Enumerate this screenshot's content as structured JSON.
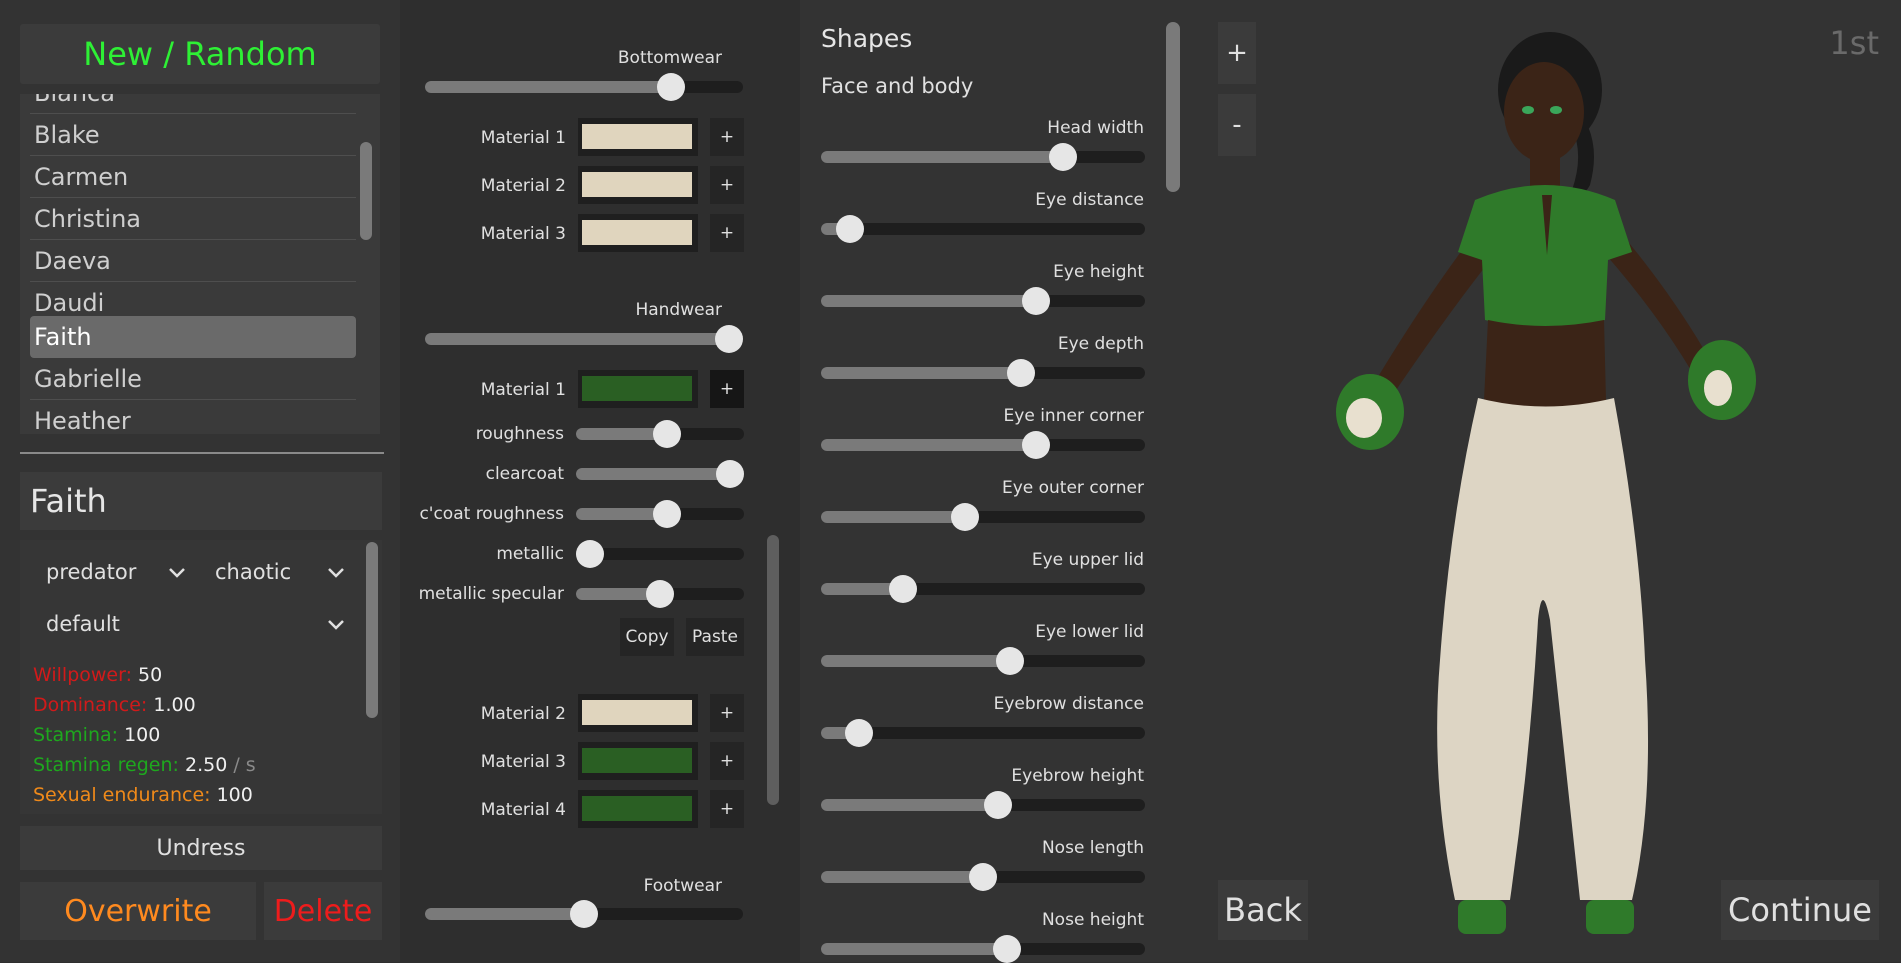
{
  "left": {
    "new_random": "New / Random",
    "names_partial": "Bianca",
    "names": [
      "Blake",
      "Carmen",
      "Christina",
      "Daeva",
      "Daudi",
      "Faith",
      "Gabrielle",
      "Heather"
    ],
    "selected_name": "Faith",
    "character_name": "Faith",
    "select_personality": "predator",
    "select_alignment": "chaotic",
    "select_preset": "default",
    "stats": {
      "willpower_label": "Willpower:",
      "willpower_value": "50",
      "dominance_label": "Dominance:",
      "dominance_value": "1.00",
      "stamina_label": "Stamina:",
      "stamina_value": "100",
      "stamina_regen_label": "Stamina regen:",
      "stamina_regen_value": "2.50",
      "stamina_regen_unit": "/ s",
      "sexual_endurance_label": "Sexual endurance:",
      "sexual_endurance_value": "100"
    },
    "undress": "Undress",
    "overwrite": "Overwrite",
    "delete": "Delete",
    "colors": {
      "new_random": "#2ef035",
      "willpower": "#d11a1a",
      "dominance": "#d11a1a",
      "stamina": "#1ea81e",
      "sexual_endurance": "#f08a1a",
      "overwrite": "#ff8a1f",
      "delete": "#ee1c1c"
    }
  },
  "clothing": {
    "bottomwear_label": "Bottomwear",
    "bottomwear_value": 0.8,
    "material_labels": [
      "Material 1",
      "Material 2",
      "Material 3"
    ],
    "bottom_swatches": [
      "#e0d5be",
      "#e0d5be",
      "#e0d5be"
    ],
    "handwear_label": "Handwear",
    "handwear_value": 1.0,
    "hand_material1_label": "Material 1",
    "hand_material1_color": "#2a5f23",
    "props": [
      {
        "label": "roughness",
        "value": 0.55
      },
      {
        "label": "clearcoat",
        "value": 1.0
      },
      {
        "label": "c'coat roughness",
        "value": 0.55
      },
      {
        "label": "metallic",
        "value": 0.0
      },
      {
        "label": "metallic specular",
        "value": 0.5
      }
    ],
    "copy": "Copy",
    "paste": "Paste",
    "hand_more": [
      {
        "label": "Material 2",
        "color": "#e0d5be"
      },
      {
        "label": "Material 3",
        "color": "#2a5f23"
      },
      {
        "label": "Material 4",
        "color": "#2a5f23"
      }
    ],
    "footwear_label": "Footwear",
    "footwear_value": 0.5,
    "plus": "+"
  },
  "shapes": {
    "title": "Shapes",
    "subtitle": "Face and body",
    "sliders": [
      {
        "label": "Head width",
        "value": 0.77
      },
      {
        "label": "Eye distance",
        "value": 0.05
      },
      {
        "label": "Eye height",
        "value": 0.68
      },
      {
        "label": "Eye depth",
        "value": 0.63
      },
      {
        "label": "Eye inner corner",
        "value": 0.68
      },
      {
        "label": "Eye outer corner",
        "value": 0.44
      },
      {
        "label": "Eye upper lid",
        "value": 0.23
      },
      {
        "label": "Eye lower lid",
        "value": 0.59
      },
      {
        "label": "Eyebrow distance",
        "value": 0.08
      },
      {
        "label": "Eyebrow height",
        "value": 0.55
      },
      {
        "label": "Nose length",
        "value": 0.5
      },
      {
        "label": "Nose height",
        "value": 0.58
      }
    ]
  },
  "viewport": {
    "zoom_in": "+",
    "zoom_out": "-",
    "camera_mode": "1st",
    "back": "Back",
    "continue": "Continue"
  }
}
